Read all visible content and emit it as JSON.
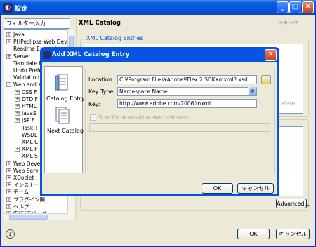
{
  "window": {
    "title": "設定",
    "filter_placeholder": "フィルター入力",
    "pane_title": "XML Catalog",
    "nav_back": "⇦",
    "nav_fwd": "⇨"
  },
  "tree": [
    {
      "label": "Java",
      "level": 0,
      "expander": "+"
    },
    {
      "label": "PHPeclipse Web Dev",
      "level": 0,
      "expander": "+"
    },
    {
      "label": "Readme Example",
      "level": 0,
      "expander": ""
    },
    {
      "label": "Server",
      "level": 0,
      "expander": "+"
    },
    {
      "label": "Template E",
      "level": 0,
      "expander": ""
    },
    {
      "label": "Undo Prefe",
      "level": 0,
      "expander": ""
    },
    {
      "label": "Validation",
      "level": 0,
      "expander": ""
    },
    {
      "label": "Web and X",
      "level": 0,
      "expander": "−"
    },
    {
      "label": "CSS F",
      "level": 1,
      "expander": "+"
    },
    {
      "label": "DTD F",
      "level": 1,
      "expander": "+"
    },
    {
      "label": "HTML",
      "level": 1,
      "expander": "+"
    },
    {
      "label": "JavaS",
      "level": 1,
      "expander": "+"
    },
    {
      "label": "JSP F",
      "level": 1,
      "expander": "+"
    },
    {
      "label": "Task T",
      "level": 1,
      "expander": ""
    },
    {
      "label": "WSDL",
      "level": 1,
      "expander": ""
    },
    {
      "label": "XML C",
      "level": 1,
      "expander": ""
    },
    {
      "label": "XML F",
      "level": 1,
      "expander": "+"
    },
    {
      "label": "XML S",
      "level": 1,
      "expander": ""
    },
    {
      "label": "Web Devel",
      "level": 0,
      "expander": "+"
    },
    {
      "label": "Web Servi",
      "level": 0,
      "expander": "+"
    },
    {
      "label": "XDoclet",
      "level": 0,
      "expander": "+"
    },
    {
      "label": "インストール",
      "level": 0,
      "expander": "+"
    },
    {
      "label": "チーム",
      "level": 0,
      "expander": "+"
    },
    {
      "label": "プラグイン開",
      "level": 0,
      "expander": "+"
    },
    {
      "label": "ヘルプ",
      "level": 0,
      "expander": "+"
    },
    {
      "label": "実行/デバッグ",
      "level": 0,
      "expander": "+"
    }
  ],
  "right_pane": {
    "entries_group": "XML Catalog Entries",
    "delete_label": "elete",
    "advanced_label": "Advanced..."
  },
  "footer": {
    "help_icon": "?",
    "ok_label": "OK",
    "cancel_label": "キャンセル"
  },
  "dialog": {
    "title": "Add XML Catalog Entry",
    "close": "✕",
    "side_items": [
      {
        "label": "Catalog Entry",
        "icon": "catalog-entry-icon"
      },
      {
        "label": "Next Catalog",
        "icon": "next-catalog-icon"
      }
    ],
    "location_label": "Location:",
    "location_value": "C:¥Program Files¥Adobe¥Flex 2 SDK¥mxml2.xsd",
    "key_type_label": "Key Type:",
    "key_type_value": "Namespace Name",
    "key_label": "Key:",
    "key_value": "http://www.adobe.com/2006/mxml",
    "alt_web_label": "Specify alternative web address",
    "ok_label": "OK",
    "cancel_label": "キャンセル"
  },
  "colors": {
    "titlebar": "#0553d6",
    "face": "#ece9d8",
    "link_blue": "#0046d5"
  }
}
